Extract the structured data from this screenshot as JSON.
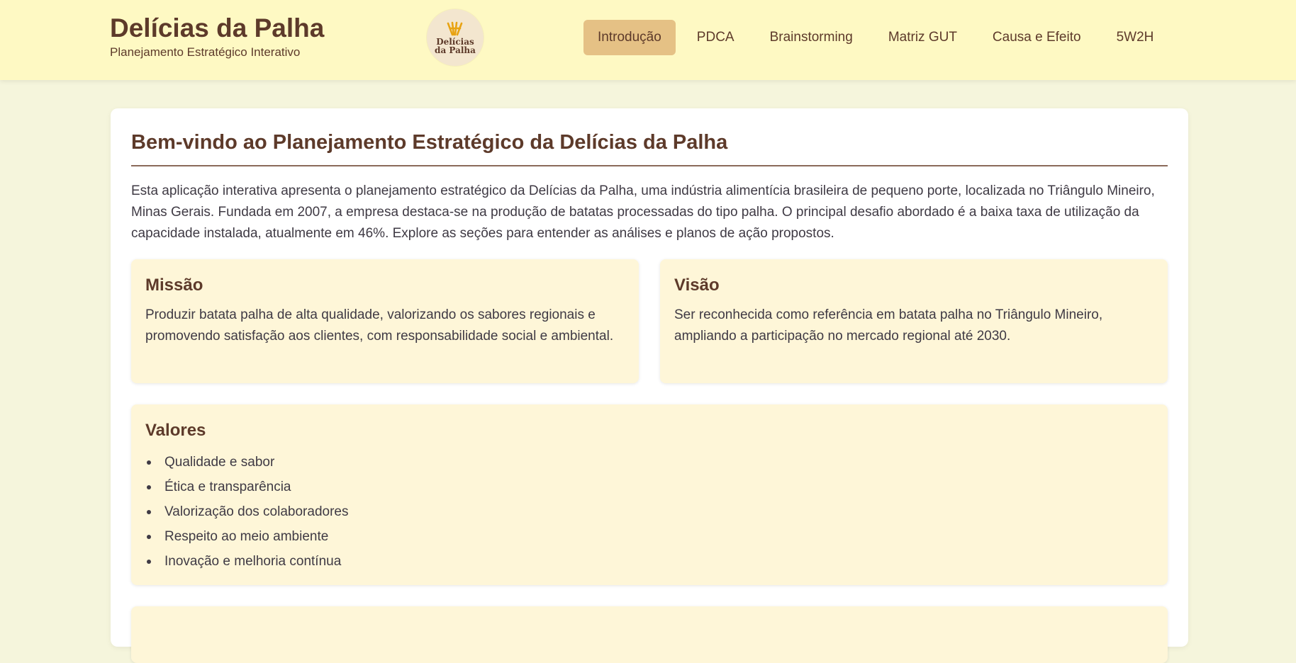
{
  "header": {
    "title": "Delícias da Palha",
    "subtitle": "Planejamento Estratégico Interativo",
    "logo": {
      "line1": "Delícias",
      "line2": "da Palha",
      "icon": "potato-straw-icon"
    },
    "nav": [
      {
        "label": "Introdução",
        "active": true
      },
      {
        "label": "PDCA",
        "active": false
      },
      {
        "label": "Brainstorming",
        "active": false
      },
      {
        "label": "Matriz GUT",
        "active": false
      },
      {
        "label": "Causa e Efeito",
        "active": false
      },
      {
        "label": "5W2H",
        "active": false
      }
    ]
  },
  "main": {
    "title": "Bem-vindo ao Planejamento Estratégico da Delícias da Palha",
    "intro": "Esta aplicação interativa apresenta o planejamento estratégico da Delícias da Palha, uma indústria alimentícia brasileira de pequeno porte, localizada no Triângulo Mineiro, Minas Gerais. Fundada em 2007, a empresa destaca-se na produção de batatas processadas do tipo palha. O principal desafio abordado é a baixa taxa de utilização da capacidade instalada, atualmente em 46%. Explore as seções para entender as análises e planos de ação propostos.",
    "mission": {
      "title": "Missão",
      "text": "Produzir batata palha de alta qualidade, valorizando os sabores regionais e promovendo satisfação aos clientes, com responsabilidade social e ambiental."
    },
    "vision": {
      "title": "Visão",
      "text": "Ser reconhecida como referência em batata palha no Triângulo Mineiro, ampliando a participação no mercado regional até 2030."
    },
    "values": {
      "title": "Valores",
      "items": [
        "Qualidade e sabor",
        "Ética e transparência",
        "Valorização dos colaboradores",
        "Respeito ao meio ambiente",
        "Inovação e melhoria contínua"
      ]
    }
  },
  "colors": {
    "header_bg": "#fef9c3",
    "page_bg": "#f5f5dc",
    "brand": "#5d3a2a",
    "active_tab": "#e5c185",
    "box_bg": "#fef6d8",
    "logo_accent": "#e8a313"
  }
}
